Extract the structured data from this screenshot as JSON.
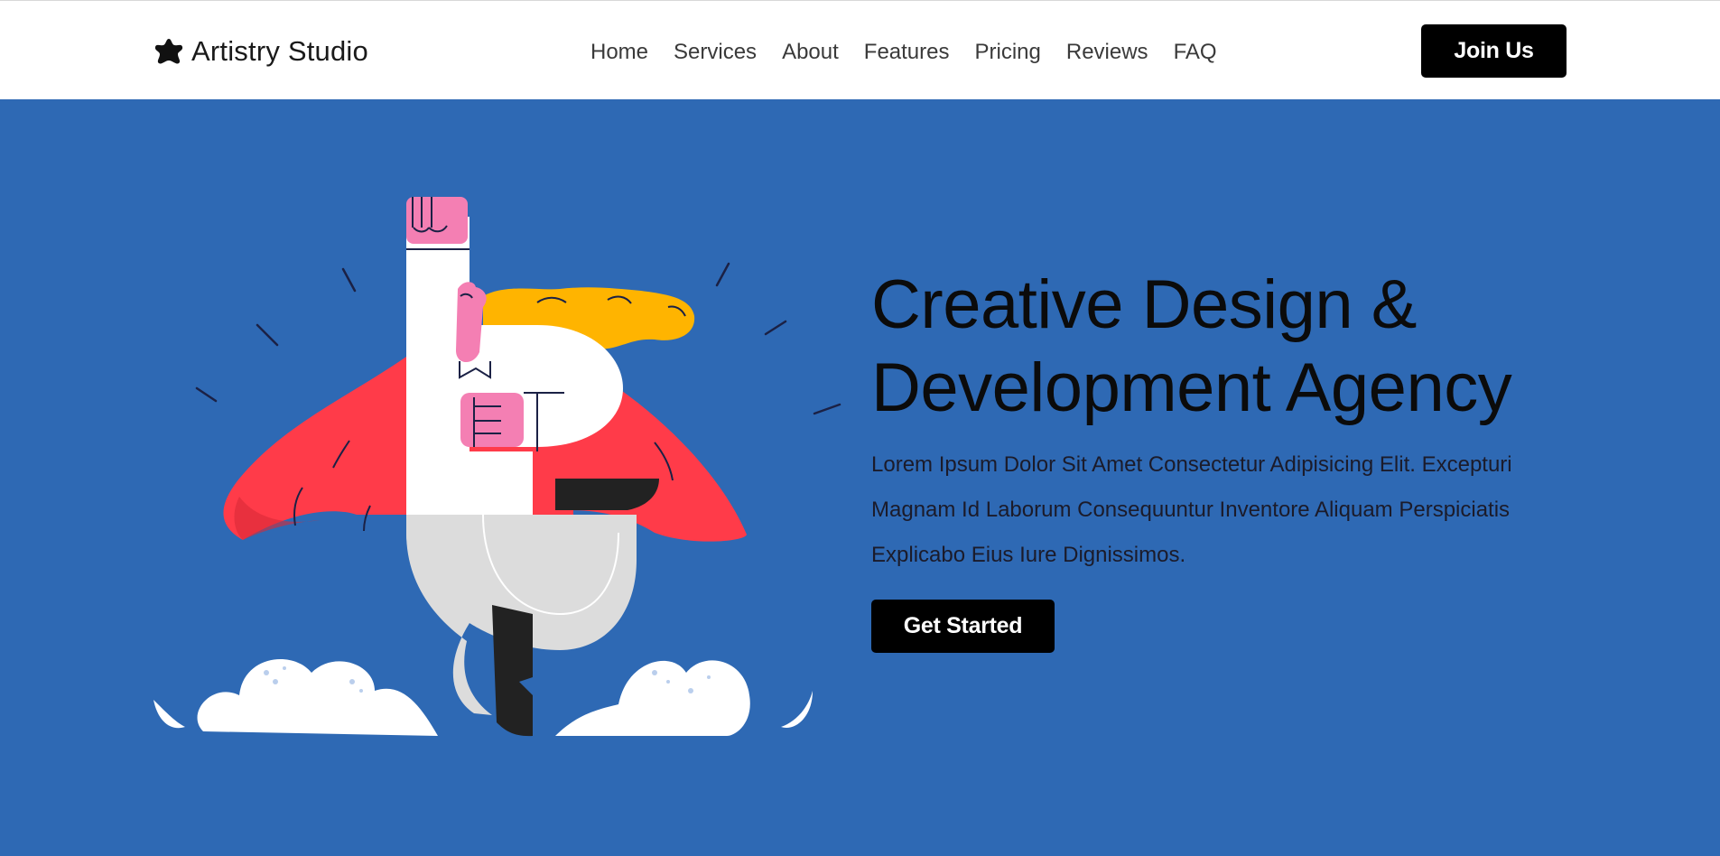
{
  "header": {
    "brand_name": "Artistry Studio",
    "brand_icon": "splat-star-icon",
    "nav": [
      {
        "label": "Home"
      },
      {
        "label": "Services"
      },
      {
        "label": "About"
      },
      {
        "label": "Features"
      },
      {
        "label": "Pricing"
      },
      {
        "label": "Reviews"
      },
      {
        "label": "FAQ"
      }
    ],
    "join_label": "Join Us"
  },
  "hero": {
    "title_line1": "Creative Design &",
    "title_line2": "Development Agency",
    "description": "Lorem Ipsum Dolor Sit Amet Consectetur Adipisicing Elit. Excepturi Magnam Id Laborum Consequuntur Inventore Aliquam Perspiciatis Explicabo Eius Iure Dignissimos.",
    "cta_label": "Get Started",
    "illustration": "superhero-letter-illustration"
  },
  "colors": {
    "hero_bg": "#2e69b4",
    "button_bg": "#000000",
    "cape": "#ff3b49",
    "hair": "#ffb400",
    "skin": "#f47fb3"
  }
}
